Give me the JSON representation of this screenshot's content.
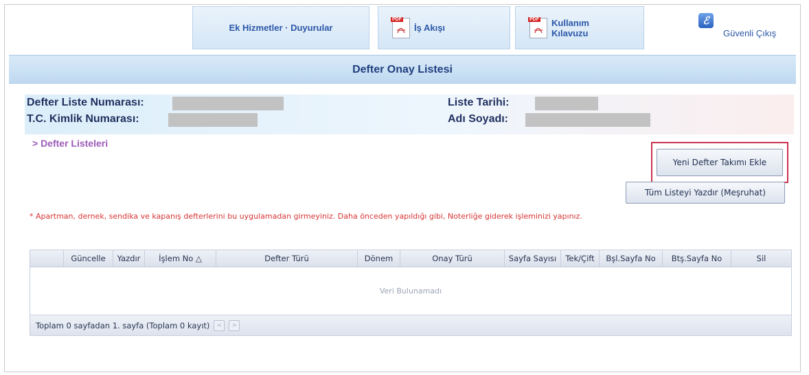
{
  "topnav": {
    "ek_hizmetler": "Ek Hizmetler · Duyurular",
    "is_akisi": "İş Akışı",
    "kullanim_line1": "Kullanım",
    "kullanim_line2": "Kılavuzu",
    "pdf_tag": "PDF",
    "guvenli_cikis": "Güvenli Çıkış"
  },
  "page_title": "Defter Onay Listesi",
  "info": {
    "defter_liste_numarasi_label": "Defter Liste Numarası:",
    "tc_kimlik_label": "T.C. Kimlik Numarası:",
    "liste_tarihi_label": "Liste Tarihi:",
    "adi_soyadi_label": "Adı Soyadı:"
  },
  "breadcrumb": "> Defter Listeleri",
  "buttons": {
    "yeni_defter": "Yeni Defter Takımı Ekle",
    "tum_listeyi_yazdir": "Tüm Listeyi Yazdır (Meşruhat)"
  },
  "warning": "* Apartman, dernek, sendika ve kapanış defterlerini bu uygulamadan girmeyiniz. Daha önceden yapıldığı gibi, Noterliğe giderek işleminizi yapınız.",
  "grid": {
    "columns": [
      "",
      "Güncelle",
      "Yazdır",
      "İşlem No  △",
      "Defter Türü",
      "Dönem",
      "Onay Türü",
      "Sayfa Sayısı",
      "Tek/Çift",
      "Bşl.Sayfa No",
      "Btş.Sayfa No",
      "Sil"
    ],
    "empty_text": "Veri Bulunamadı",
    "footer_text": "Toplam 0 sayfadan 1. sayfa (Toplam 0 kayıt)",
    "prev_glyph": "<",
    "next_glyph": ">"
  },
  "colors": {
    "accent": "#2b57a8",
    "warning": "#d73333",
    "highlight_border": "#c9304d",
    "title_bar": "#c9dff3"
  },
  "icons": {
    "pdf": "pdf-file-icon",
    "exit": "secure-exit-icon"
  }
}
